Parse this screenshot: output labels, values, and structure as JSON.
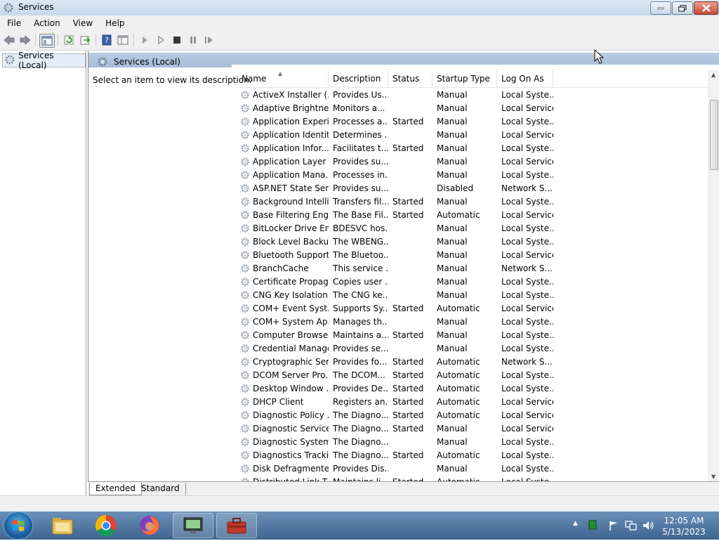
{
  "window": {
    "title": "Services"
  },
  "menu": [
    "File",
    "Action",
    "View",
    "Help"
  ],
  "tree": {
    "root_label": "Services (Local)"
  },
  "pane": {
    "header_title": "Services (Local)",
    "description_prompt": "Select an item to view its description."
  },
  "columns": {
    "name": "Name",
    "description": "Description",
    "status": "Status",
    "startup_type": "Startup Type",
    "log_on_as": "Log On As"
  },
  "services": [
    {
      "name": "ActiveX Installer (...",
      "description": "Provides Us...",
      "status": "",
      "startup": "Manual",
      "logon": "Local Syste..."
    },
    {
      "name": "Adaptive Brightness",
      "description": "Monitors a...",
      "status": "",
      "startup": "Manual",
      "logon": "Local Service"
    },
    {
      "name": "Application Experi...",
      "description": "Processes a...",
      "status": "Started",
      "startup": "Manual",
      "logon": "Local Syste..."
    },
    {
      "name": "Application Identity",
      "description": "Determines ...",
      "status": "",
      "startup": "Manual",
      "logon": "Local Service"
    },
    {
      "name": "Application Infor...",
      "description": "Facilitates t...",
      "status": "Started",
      "startup": "Manual",
      "logon": "Local Syste..."
    },
    {
      "name": "Application Layer ...",
      "description": "Provides su...",
      "status": "",
      "startup": "Manual",
      "logon": "Local Service"
    },
    {
      "name": "Application Mana...",
      "description": "Processes in...",
      "status": "",
      "startup": "Manual",
      "logon": "Local Syste..."
    },
    {
      "name": "ASP.NET State Ser...",
      "description": "Provides su...",
      "status": "",
      "startup": "Disabled",
      "logon": "Network S..."
    },
    {
      "name": "Background Intelli...",
      "description": "Transfers fil...",
      "status": "Started",
      "startup": "Manual",
      "logon": "Local Syste..."
    },
    {
      "name": "Base Filtering Engi...",
      "description": "The Base Fil...",
      "status": "Started",
      "startup": "Automatic",
      "logon": "Local Service"
    },
    {
      "name": "BitLocker Drive En...",
      "description": "BDESVC hos...",
      "status": "",
      "startup": "Manual",
      "logon": "Local Syste..."
    },
    {
      "name": "Block Level Backu...",
      "description": "The WBENG...",
      "status": "",
      "startup": "Manual",
      "logon": "Local Syste..."
    },
    {
      "name": "Bluetooth Support...",
      "description": "The Bluetoo...",
      "status": "",
      "startup": "Manual",
      "logon": "Local Service"
    },
    {
      "name": "BranchCache",
      "description": "This service ...",
      "status": "",
      "startup": "Manual",
      "logon": "Network S..."
    },
    {
      "name": "Certificate Propag...",
      "description": "Copies user ...",
      "status": "",
      "startup": "Manual",
      "logon": "Local Syste..."
    },
    {
      "name": "CNG Key Isolation",
      "description": "The CNG ke...",
      "status": "",
      "startup": "Manual",
      "logon": "Local Syste..."
    },
    {
      "name": "COM+ Event Syst...",
      "description": "Supports Sy...",
      "status": "Started",
      "startup": "Automatic",
      "logon": "Local Service"
    },
    {
      "name": "COM+ System Ap...",
      "description": "Manages th...",
      "status": "",
      "startup": "Manual",
      "logon": "Local Syste..."
    },
    {
      "name": "Computer Browser",
      "description": "Maintains a...",
      "status": "Started",
      "startup": "Manual",
      "logon": "Local Syste..."
    },
    {
      "name": "Credential Manager",
      "description": "Provides se...",
      "status": "",
      "startup": "Manual",
      "logon": "Local Syste..."
    },
    {
      "name": "Cryptographic Ser...",
      "description": "Provides fo...",
      "status": "Started",
      "startup": "Automatic",
      "logon": "Network S..."
    },
    {
      "name": "DCOM Server Pro...",
      "description": "The DCOM...",
      "status": "Started",
      "startup": "Automatic",
      "logon": "Local Syste..."
    },
    {
      "name": "Desktop Window ...",
      "description": "Provides De...",
      "status": "Started",
      "startup": "Automatic",
      "logon": "Local Syste..."
    },
    {
      "name": "DHCP Client",
      "description": "Registers an...",
      "status": "Started",
      "startup": "Automatic",
      "logon": "Local Service"
    },
    {
      "name": "Diagnostic Policy ...",
      "description": "The Diagno...",
      "status": "Started",
      "startup": "Automatic",
      "logon": "Local Service"
    },
    {
      "name": "Diagnostic Service...",
      "description": "The Diagno...",
      "status": "Started",
      "startup": "Manual",
      "logon": "Local Service"
    },
    {
      "name": "Diagnostic System...",
      "description": "The Diagno...",
      "status": "",
      "startup": "Manual",
      "logon": "Local Syste..."
    },
    {
      "name": "Diagnostics Tracki...",
      "description": "The Diagno...",
      "status": "Started",
      "startup": "Automatic",
      "logon": "Local Syste..."
    },
    {
      "name": "Disk Defragmenter",
      "description": "Provides Dis...",
      "status": "",
      "startup": "Manual",
      "logon": "Local Syste..."
    },
    {
      "name": "Distributed Link T...",
      "description": "Maintains li...",
      "status": "Started",
      "startup": "Automatic",
      "logon": "Local Syste..."
    }
  ],
  "tabs": [
    "Extended",
    "Standard"
  ],
  "taskbar": {
    "apps": [
      "file-explorer",
      "chrome",
      "firefox",
      "remote-desktop",
      "services"
    ],
    "time": "12:05 AM",
    "date": "5/13/2023"
  }
}
